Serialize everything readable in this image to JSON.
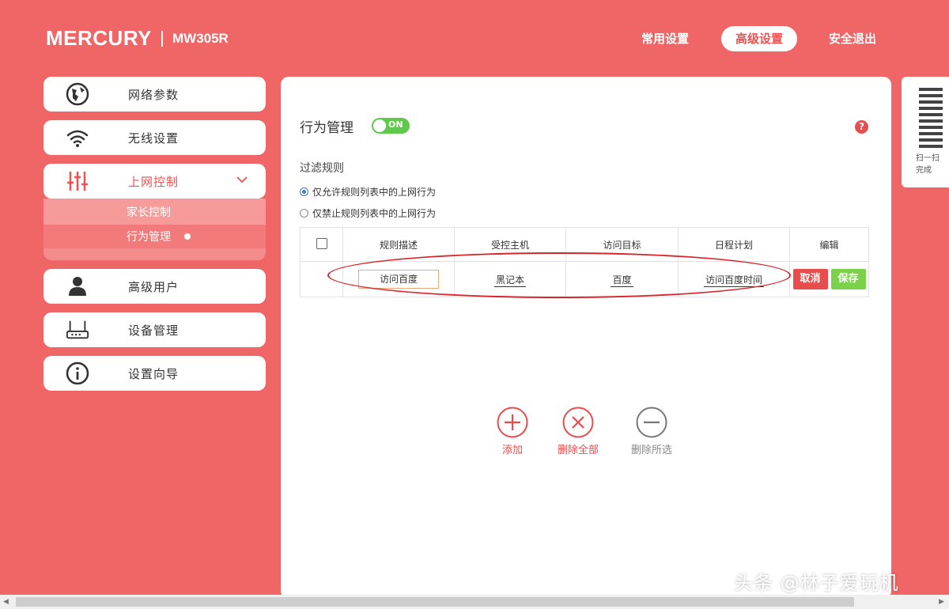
{
  "header": {
    "brand": "MERCURY",
    "model": "MW305R",
    "nav": {
      "common": "常用设置",
      "advanced": "高级设置",
      "logout": "安全退出"
    }
  },
  "sidebar": {
    "items": [
      {
        "label": "网络参数",
        "icon": "globe-icon"
      },
      {
        "label": "无线设置",
        "icon": "wifi-icon"
      },
      {
        "label": "上网控制",
        "icon": "sliders-icon"
      },
      {
        "label": "高级用户",
        "icon": "user-icon"
      },
      {
        "label": "设备管理",
        "icon": "router-icon"
      },
      {
        "label": "设置向导",
        "icon": "info-icon"
      }
    ],
    "submenu": {
      "parent_control": "家长控制",
      "behavior": "行为管理"
    }
  },
  "main": {
    "title": "行为管理",
    "toggle_label": "ON",
    "help": "?",
    "rule_title": "过滤规则",
    "radio_allow": "仅允许规则列表中的上网行为",
    "radio_block": "仅禁止规则列表中的上网行为",
    "table": {
      "headers": [
        "规则描述",
        "受控主机",
        "访问目标",
        "日程计划",
        "编辑"
      ],
      "row": {
        "desc": "访问百度",
        "host": "黑记本",
        "target": "百度",
        "schedule": "访问百度时间"
      },
      "cancel": "取消",
      "save": "保存"
    },
    "actions": {
      "add": "添加",
      "delete_all": "删除全部",
      "delete_selected": "删除所选"
    }
  },
  "qr": {
    "text": "扫一扫 完成"
  },
  "watermark": "头条 @林子爱玩机",
  "colors": {
    "brand": "#f06565",
    "accent": "#ef5151",
    "ok": "#7bd24a"
  }
}
